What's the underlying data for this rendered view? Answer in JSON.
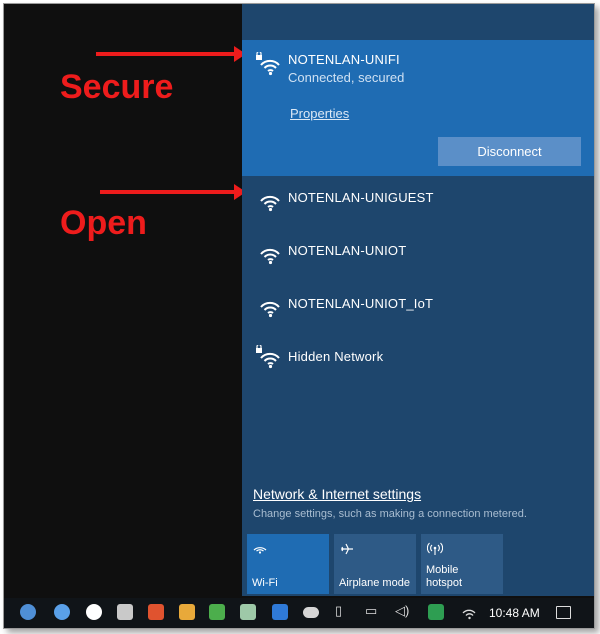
{
  "annotations": {
    "secure_label": "Secure",
    "open_label": "Open",
    "color": "#ee1c1c"
  },
  "networks": {
    "connected": {
      "name": "NOTENLAN-UNIFI",
      "status": "Connected, secured",
      "properties_label": "Properties",
      "disconnect_label": "Disconnect",
      "secured": true
    },
    "list": [
      {
        "name": "NOTENLAN-UNIGUEST",
        "secured": false
      },
      {
        "name": "NOTENLAN-UNIOT",
        "secured": false
      },
      {
        "name": "NOTENLAN-UNIOT_IoT",
        "secured": false
      },
      {
        "name": "Hidden Network",
        "secured": true
      }
    ]
  },
  "settings": {
    "link_label": "Network & Internet settings",
    "description": "Change settings, such as making a connection metered."
  },
  "quick_actions": [
    {
      "label": "Wi-Fi",
      "icon": "wifi-icon",
      "active": true
    },
    {
      "label": "Airplane mode",
      "icon": "airplane-icon",
      "active": false
    },
    {
      "label": "Mobile hotspot",
      "icon": "hotspot-icon",
      "active": false
    }
  ],
  "taskbar": {
    "clock": "10:48 AM"
  },
  "colors": {
    "panel_bg": "#1e466d",
    "connected_bg": "#1f6cb3",
    "button_bg": "#5b8fc8",
    "tile_bg": "#2e5a86"
  }
}
